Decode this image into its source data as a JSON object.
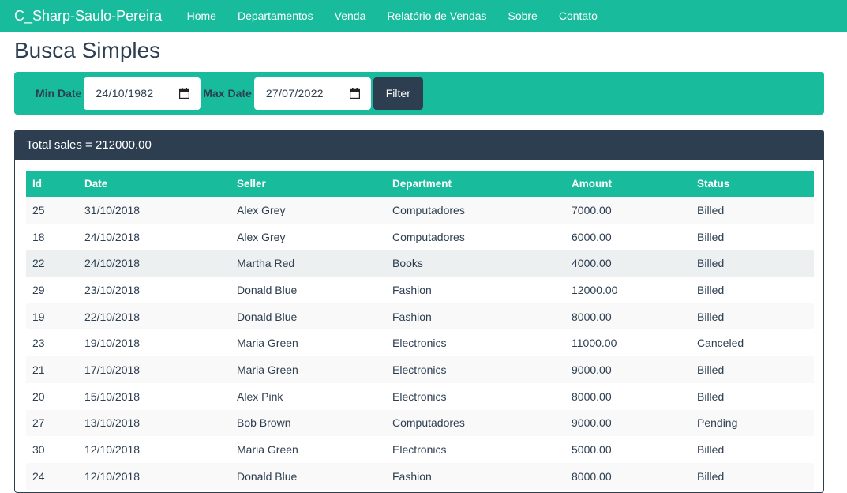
{
  "navbar": {
    "brand": "C_Sharp-Saulo-Pereira",
    "links": [
      "Home",
      "Departamentos",
      "Venda",
      "Relatório de Vendas",
      "Sobre",
      "Contato"
    ]
  },
  "page": {
    "title": "Busca Simples"
  },
  "filter": {
    "min_label": "Min Date",
    "min_value": "24/10/1982",
    "max_label": "Max Date",
    "max_value": "27/07/2022",
    "button_label": "Filter"
  },
  "panel": {
    "heading": "Total sales = 212000.00"
  },
  "table": {
    "headers": [
      "Id",
      "Date",
      "Seller",
      "Department",
      "Amount",
      "Status"
    ],
    "rows": [
      [
        "25",
        "31/10/2018",
        "Alex Grey",
        "Computadores",
        "7000.00",
        "Billed"
      ],
      [
        "18",
        "24/10/2018",
        "Alex Grey",
        "Computadores",
        "6000.00",
        "Billed"
      ],
      [
        "22",
        "24/10/2018",
        "Martha Red",
        "Books",
        "4000.00",
        "Billed"
      ],
      [
        "29",
        "23/10/2018",
        "Donald Blue",
        "Fashion",
        "12000.00",
        "Billed"
      ],
      [
        "19",
        "22/10/2018",
        "Donald Blue",
        "Fashion",
        "8000.00",
        "Billed"
      ],
      [
        "23",
        "19/10/2018",
        "Maria Green",
        "Electronics",
        "11000.00",
        "Canceled"
      ],
      [
        "21",
        "17/10/2018",
        "Maria Green",
        "Electronics",
        "9000.00",
        "Billed"
      ],
      [
        "20",
        "15/10/2018",
        "Alex Pink",
        "Electronics",
        "8000.00",
        "Billed"
      ],
      [
        "27",
        "13/10/2018",
        "Bob Brown",
        "Computadores",
        "9000.00",
        "Pending"
      ],
      [
        "30",
        "12/10/2018",
        "Maria Green",
        "Electronics",
        "5000.00",
        "Billed"
      ],
      [
        "24",
        "12/10/2018",
        "Donald Blue",
        "Fashion",
        "8000.00",
        "Billed"
      ]
    ]
  },
  "colors": {
    "accent": "#18bc9c",
    "primary": "#2c3e50",
    "row_hover": "#ecf0f1"
  },
  "icons": {
    "date_picker": "calendar-icon"
  }
}
